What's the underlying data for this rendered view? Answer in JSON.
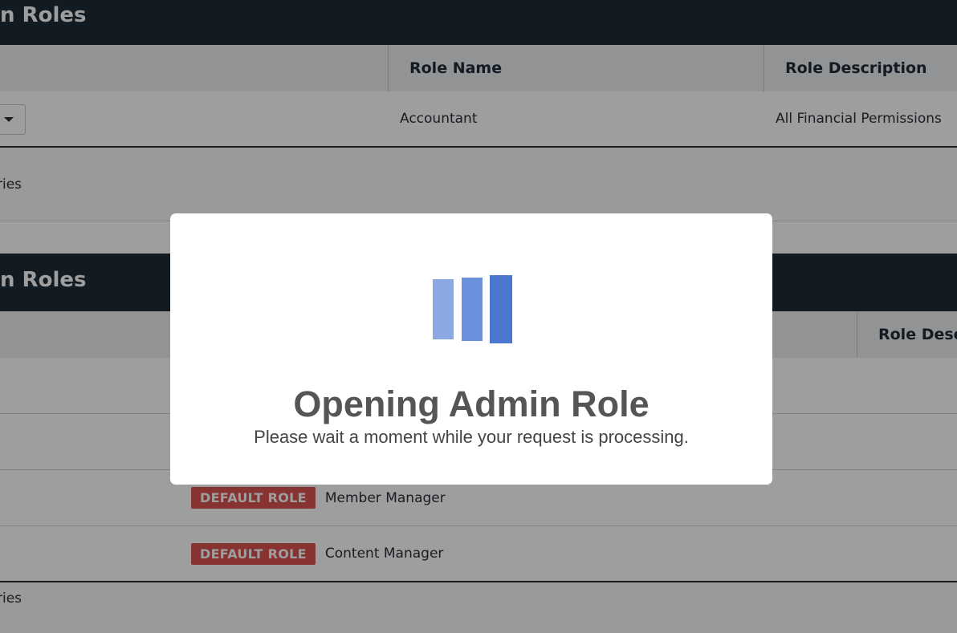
{
  "sections": [
    {
      "title": "n Roles",
      "columns": [
        "Role Name",
        "Role Description"
      ],
      "row": {
        "name": "Accountant",
        "description": "All Financial Permissions"
      },
      "footer_text": "ries"
    },
    {
      "title": "n Roles",
      "columns": [
        "Role Desc"
      ],
      "rows": [
        {
          "badge": "DEFAULT ROLE",
          "name": "Member Manager"
        },
        {
          "badge": "DEFAULT ROLE",
          "name": "Content Manager"
        }
      ],
      "footer_text": "ries"
    }
  ],
  "modal": {
    "title": "Opening Admin Role",
    "subtitle": "Please wait a moment while your request is processing."
  },
  "colors": {
    "header_bg": "#1d2a38",
    "badge_bg": "#d9534f",
    "spinner_light": "#8ca8e0",
    "spinner_mid": "#6a90dc",
    "spinner_dark": "#4a78d0"
  }
}
